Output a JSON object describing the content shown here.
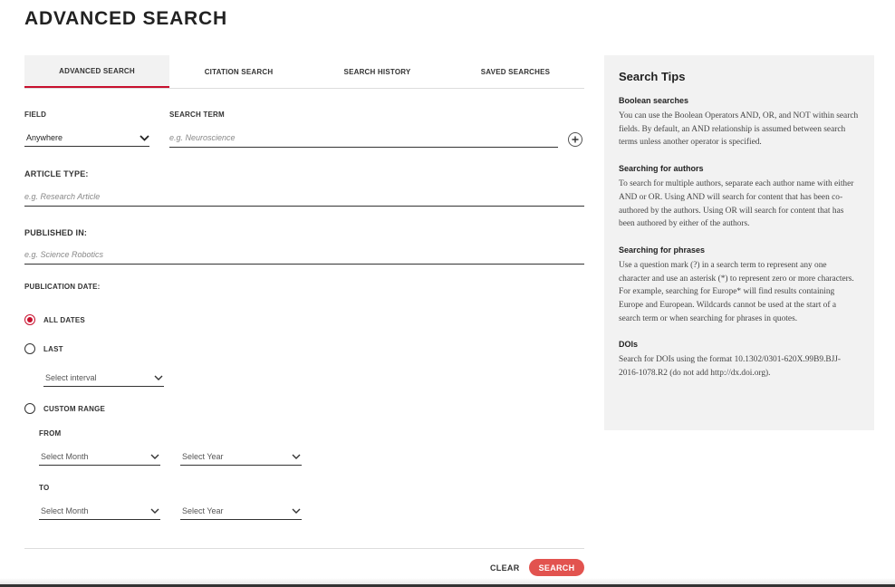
{
  "page": {
    "title": "ADVANCED SEARCH"
  },
  "tabs": [
    {
      "label": "ADVANCED SEARCH",
      "active": true
    },
    {
      "label": "CITATION SEARCH",
      "active": false
    },
    {
      "label": "SEARCH HISTORY",
      "active": false
    },
    {
      "label": "SAVED SEARCHES",
      "active": false
    }
  ],
  "form": {
    "field_label": "FIELD",
    "field_value": "Anywhere",
    "search_term_label": "SEARCH TERM",
    "search_term_placeholder": "e.g. Neuroscience",
    "article_type_label": "ARTICLE TYPE:",
    "article_type_placeholder": "e.g. Research Article",
    "published_in_label": "PUBLISHED IN:",
    "published_in_placeholder": "e.g. Science Robotics",
    "publication_date_label": "PUBLICATION DATE:",
    "all_dates_label": "ALL DATES",
    "last_label": "LAST",
    "interval_placeholder": "Select interval",
    "custom_range_label": "CUSTOM RANGE",
    "from_label": "FROM",
    "to_label": "TO",
    "month_placeholder": "Select Month",
    "year_placeholder": "Select Year",
    "selected_date_option": "ALL DATES"
  },
  "actions": {
    "clear_label": "CLEAR",
    "search_label": "SEARCH"
  },
  "tips": {
    "title": "Search Tips",
    "sections": [
      {
        "heading": "Boolean searches",
        "body": "You can use the Boolean Operators AND, OR, and NOT within search fields. By default, an AND relationship is assumed between search terms unless another operator is specified."
      },
      {
        "heading": "Searching for authors",
        "body": "To search for multiple authors, separate each author name with either AND or OR. Using AND will search for content that has been co-authored by the authors. Using OR will search for content that has been authored by either of the authors."
      },
      {
        "heading": "Searching for phrases",
        "body": "Use a question mark (?) in a search term to represent any one character and use an asterisk (*) to represent zero or more characters. For example, searching for Europe* will find results containing Europe and European. Wildcards cannot be used at the start of a search term or when searching for phrases in quotes."
      },
      {
        "heading": "DOIs",
        "body": "Search for DOIs using the format 10.1302/0301-620X.99B9.BJJ-2016-1078.R2 (do not add http://dx.doi.org)."
      }
    ]
  },
  "colors": {
    "accent": "#c8102e",
    "search_button": "#e2534f",
    "panel_bg": "#f2f2f2"
  },
  "icons": {
    "chevron": "chevron-down-icon",
    "plus": "plus-icon"
  }
}
